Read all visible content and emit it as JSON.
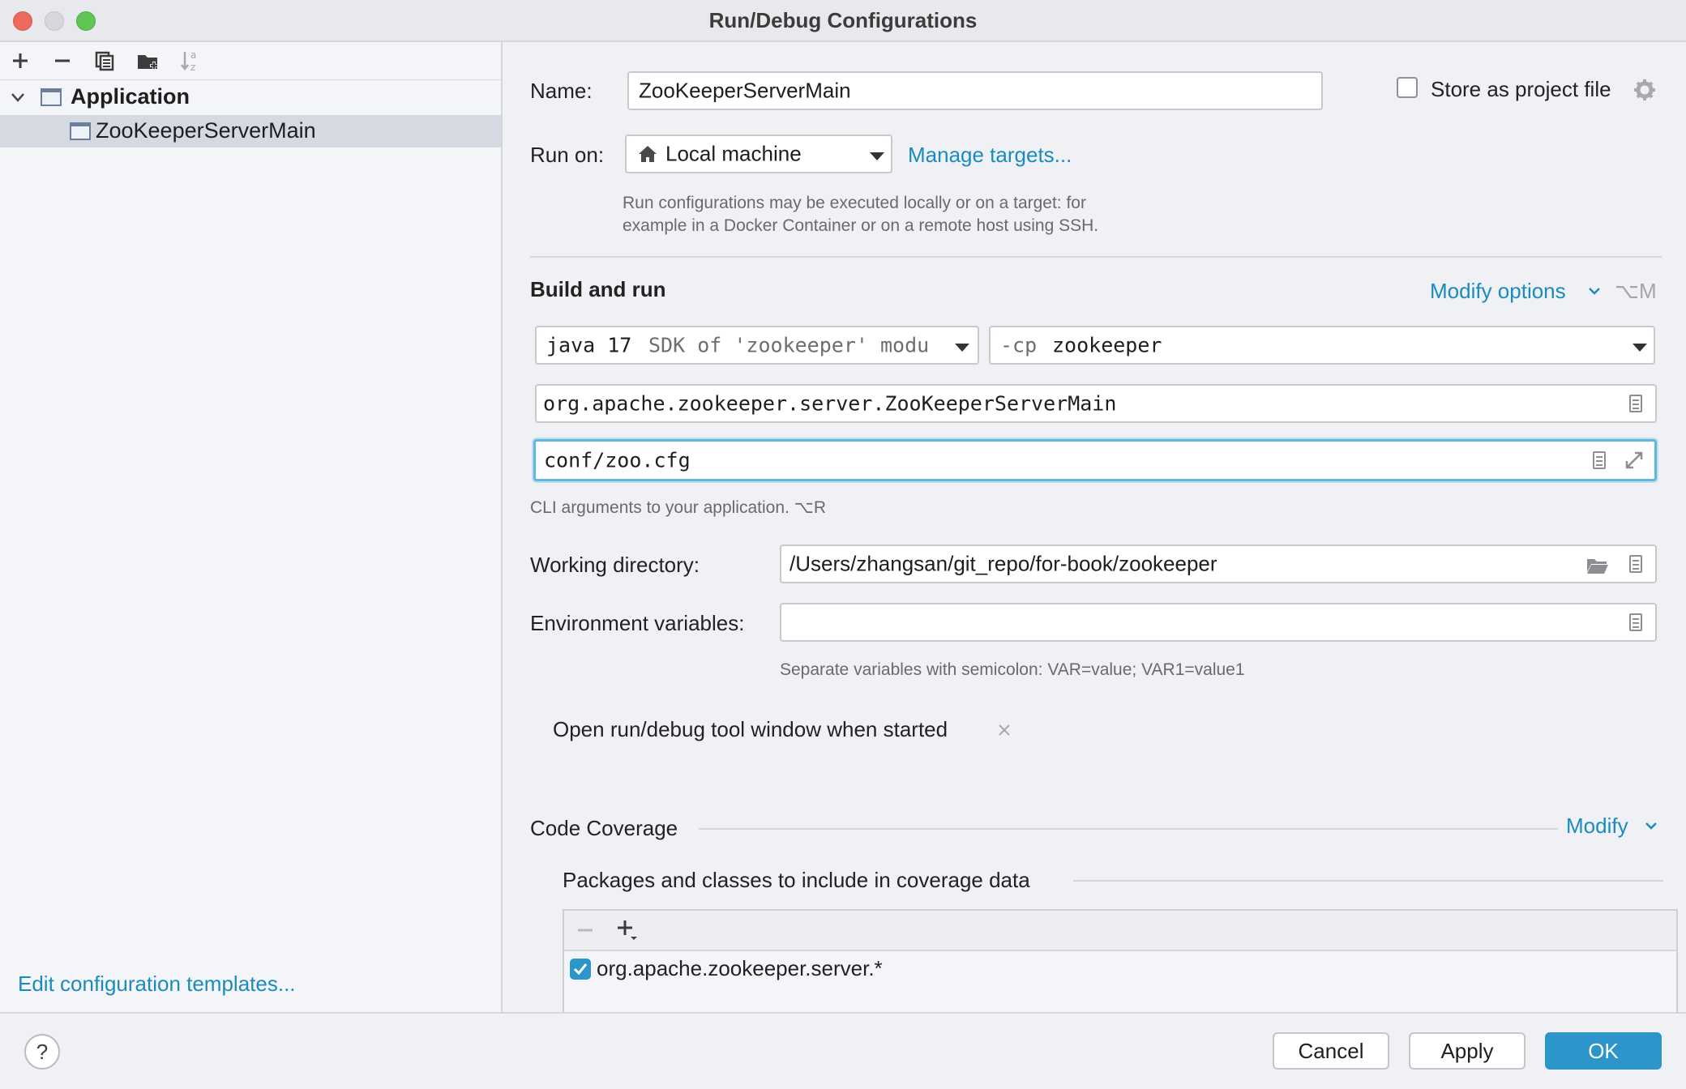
{
  "window": {
    "title": "Run/Debug Configurations",
    "traffic_light_colors": {
      "close": "#ed6a5e",
      "minimize": "#d8d8db",
      "maximize": "#61c554"
    }
  },
  "sidebar": {
    "toolbar_icons": [
      "add-icon",
      "remove-icon",
      "copy-icon",
      "new-folder-icon",
      "sort-icon"
    ],
    "tree": {
      "group_label": "Application",
      "item_label": "ZooKeeperServerMain"
    },
    "edit_templates_link": "Edit configuration templates..."
  },
  "form": {
    "name_label": "Name:",
    "name_value": "ZooKeeperServerMain",
    "store_label": "Store as project file",
    "store_checked": false,
    "run_on_label": "Run on:",
    "run_on_value": "Local machine",
    "manage_targets_link": "Manage targets...",
    "run_on_hint_line1": "Run configurations may be executed locally or on a target: for",
    "run_on_hint_line2": "example in a Docker Container or on a remote host using SSH.",
    "build_run_title": "Build and run",
    "modify_options_link": "Modify options",
    "modify_options_shortcut": "⌥M",
    "jdk_main": "java 17",
    "jdk_detail": "SDK of 'zookeeper' modu",
    "classpath_flag": "-cp",
    "classpath_value": "zookeeper",
    "main_class_value": "org.apache.zookeeper.server.ZooKeeperServerMain",
    "program_args_value": "conf/zoo.cfg",
    "program_args_hint": "CLI arguments to your application. ⌥R",
    "working_dir_label": "Working directory:",
    "working_dir_value": "/Users/zhangsan/git_repo/for-book/zookeeper",
    "env_vars_label": "Environment variables:",
    "env_vars_value": "",
    "env_vars_hint": "Separate variables with semicolon: VAR=value; VAR1=value1",
    "tool_window_option": "Open run/debug tool window when started",
    "code_coverage_title": "Code Coverage",
    "coverage_modify_link": "Modify",
    "coverage_packages_title": "Packages and classes to include in coverage data",
    "coverage_entries": [
      {
        "pattern": "org.apache.zookeeper.server.*",
        "checked": true
      }
    ]
  },
  "buttons": {
    "help": "?",
    "cancel": "Cancel",
    "apply": "Apply",
    "ok": "OK"
  },
  "colors": {
    "accent": "#2c95c9",
    "link": "#1b8bbd",
    "selection": "#d4d9e2",
    "focus_border": "#5fb6de"
  }
}
